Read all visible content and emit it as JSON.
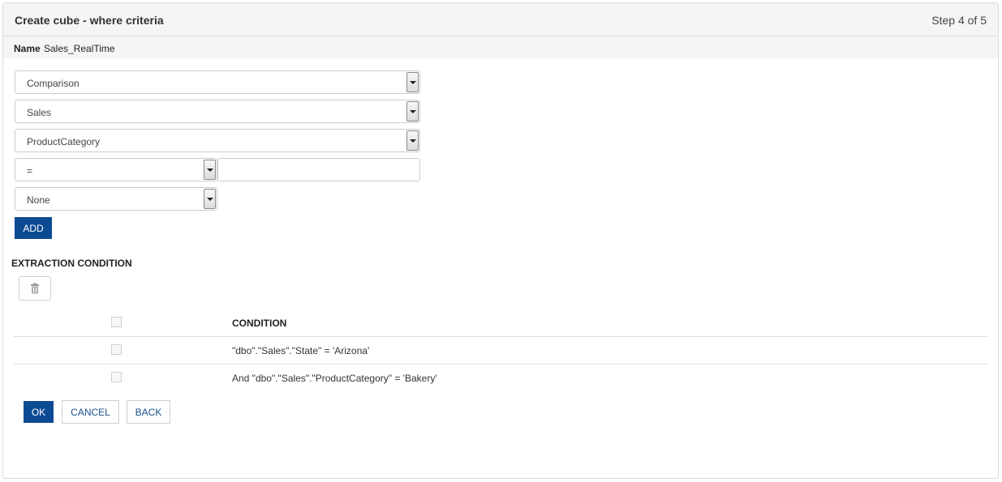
{
  "header": {
    "title": "Create cube - where criteria",
    "step": "Step 4 of 5"
  },
  "name_bar": {
    "label": "Name",
    "value": "Sales_RealTime"
  },
  "form": {
    "type_select": "Comparison",
    "table_select": "Sales",
    "column_select": "ProductCategory",
    "operator_select": "=",
    "value_input": "",
    "conjunction_select": "None",
    "add_label": "ADD"
  },
  "extraction": {
    "title": "EXTRACTION CONDITION",
    "delete_icon": "trash-icon",
    "column_header": "CONDITION",
    "rows": [
      {
        "condition": "\"dbo\".\"Sales\".\"State\" = 'Arizona'"
      },
      {
        "condition": "And \"dbo\".\"Sales\".\"ProductCategory\" = 'Bakery'"
      }
    ]
  },
  "footer": {
    "ok_label": "OK",
    "cancel_label": "CANCEL",
    "back_label": "BACK"
  },
  "colors": {
    "primary": "#0d4a94",
    "header_bg": "#f5f5f5",
    "border": "#dddddd"
  }
}
